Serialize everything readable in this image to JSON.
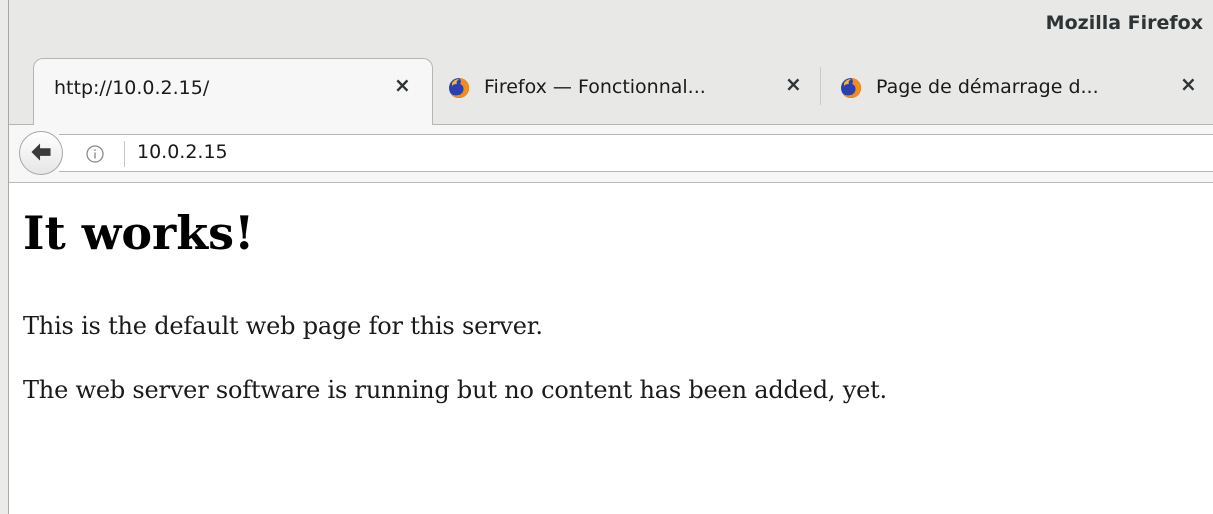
{
  "window": {
    "title": "Mozilla Firefox"
  },
  "tabs": [
    {
      "label": "http://10.0.2.15/",
      "active": true,
      "icon": "none"
    },
    {
      "label": "Firefox — Fonctionnal...",
      "active": false,
      "icon": "firefox-icon"
    },
    {
      "label": "Page de démarrage d...",
      "active": false,
      "icon": "firefox-icon"
    }
  ],
  "tab_close_glyph": "×",
  "navbar": {
    "url": "10.0.2.15",
    "back_icon": "back-arrow-icon",
    "site_info_icon": "info-icon"
  },
  "page": {
    "heading": "It works!",
    "paragraph_1": "This is the default web page for this server.",
    "paragraph_2": "The web server software is running but no content has been added, yet."
  },
  "colors": {
    "chrome_bg": "#e8e8e7",
    "tab_active_bg": "#f7f7f7",
    "text": "#1a1a1a"
  }
}
